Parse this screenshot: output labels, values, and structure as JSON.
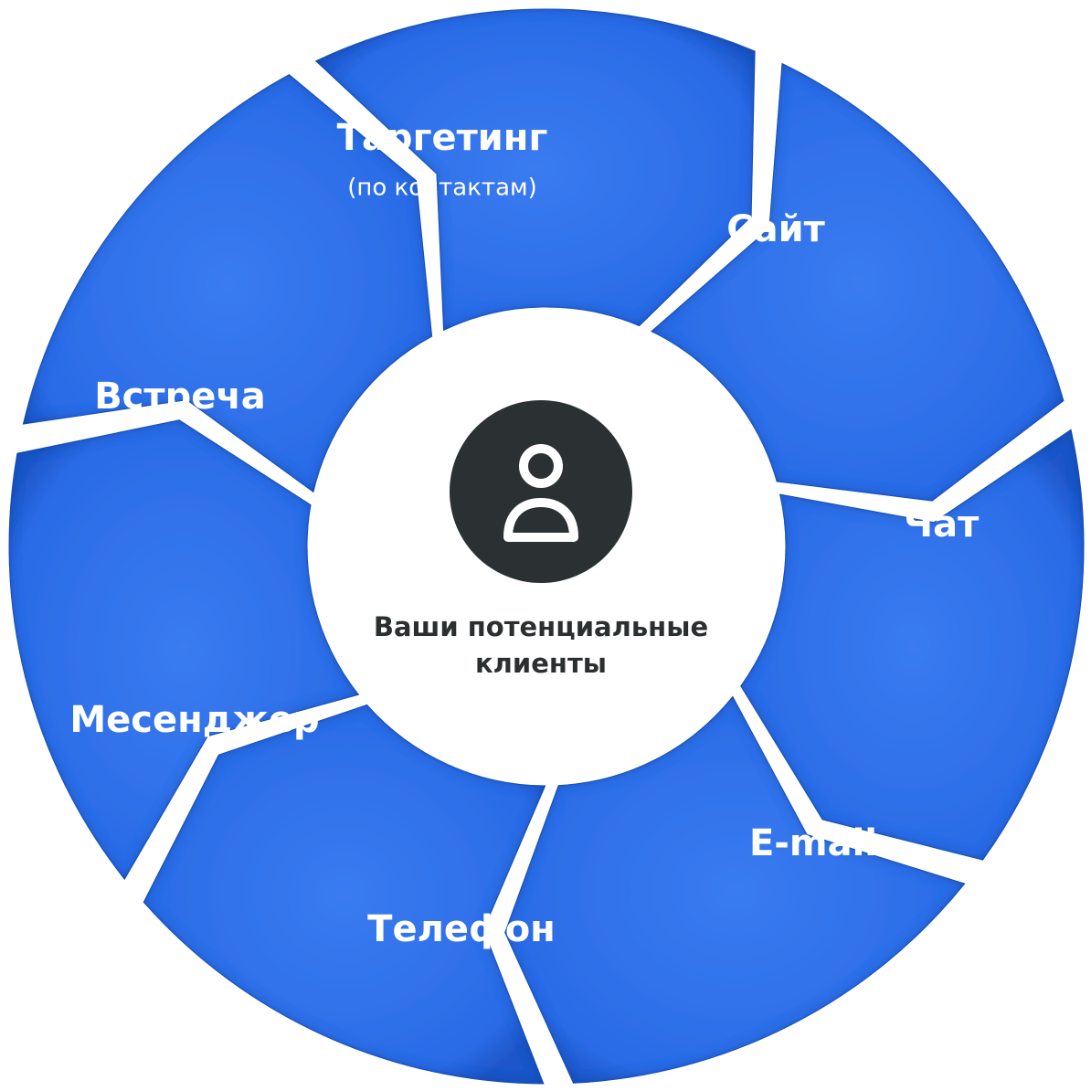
{
  "center": {
    "line1": "Ваши потенциальные",
    "line2": "клиенты",
    "icon": "user-icon"
  },
  "segments": [
    {
      "id": "targeting",
      "label": "Таргетинг",
      "sublabel": "(по контактам)"
    },
    {
      "id": "site",
      "label": "Сайт"
    },
    {
      "id": "chat",
      "label": "Чат"
    },
    {
      "id": "email",
      "label": "E-mail"
    },
    {
      "id": "phone",
      "label": "Телефон"
    },
    {
      "id": "messenger",
      "label": "Месенджер"
    },
    {
      "id": "meeting",
      "label": "Встреча"
    }
  ],
  "colors": {
    "segment": "#2a6be6",
    "segment_light": "#4a86f2",
    "segment_dark": "#1e56c8",
    "center_circle": "#2b3133",
    "center_text": "#2b2f30"
  }
}
